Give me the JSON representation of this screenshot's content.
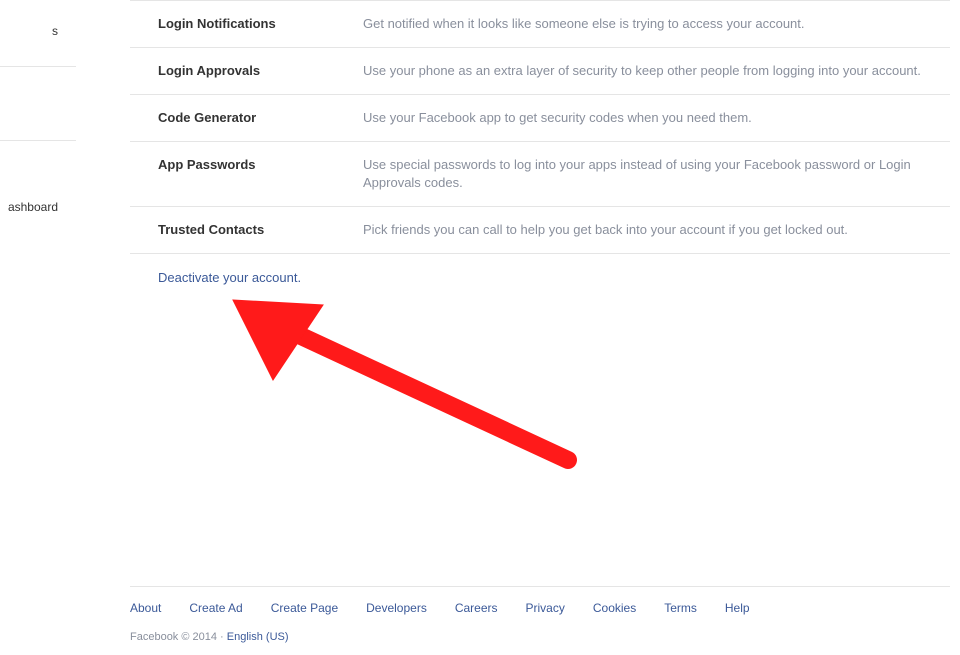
{
  "sidebar": {
    "frag1": "s",
    "frag2": "ashboard"
  },
  "security_rows": [
    {
      "label": "Login Notifications",
      "desc": "Get notified when it looks like someone else is trying to access your account."
    },
    {
      "label": "Login Approvals",
      "desc": "Use your phone as an extra layer of security to keep other people from logging into your account."
    },
    {
      "label": "Code Generator",
      "desc": "Use your Facebook app to get security codes when you need them."
    },
    {
      "label": "App Passwords",
      "desc": "Use special passwords to log into your apps instead of using your Facebook password or Login Approvals codes."
    },
    {
      "label": "Trusted Contacts",
      "desc": "Pick friends you can call to help you get back into your account if you get locked out."
    }
  ],
  "deactivate": {
    "label": "Deactivate your account."
  },
  "footer": {
    "links": [
      "About",
      "Create Ad",
      "Create Page",
      "Developers",
      "Careers",
      "Privacy",
      "Cookies",
      "Terms",
      "Help"
    ],
    "copyright": "Facebook © 2014 · ",
    "language": "English (US)"
  }
}
